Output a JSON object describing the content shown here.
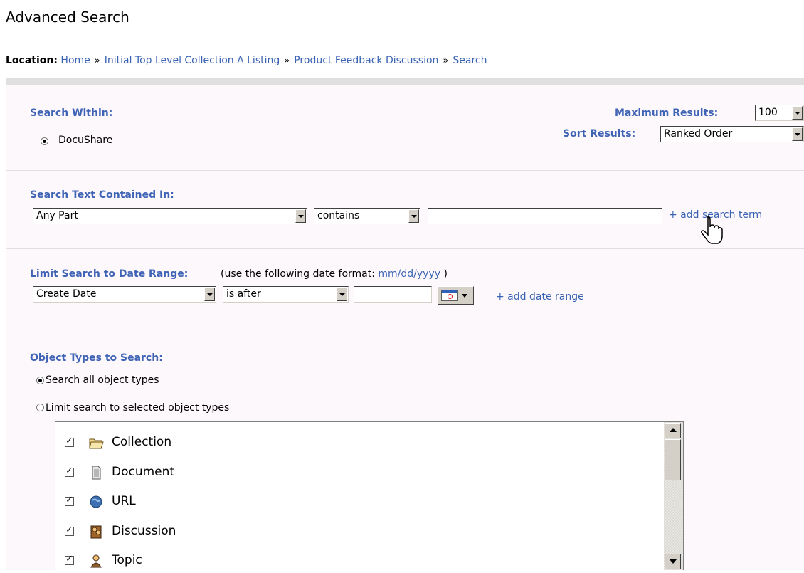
{
  "page": {
    "title": "Advanced Search"
  },
  "location": {
    "label": "Location:",
    "separator": "»",
    "crumbs": [
      "Home",
      "Initial Top Level Collection A Listing",
      "Product Feedback Discussion",
      "Search"
    ]
  },
  "search_within": {
    "label": "Search Within:",
    "option": "DocuShare",
    "selected": true
  },
  "max_results": {
    "label": "Maximum Results:",
    "value": "100"
  },
  "sort_results": {
    "label": "Sort Results:",
    "value": "Ranked Order"
  },
  "search_text": {
    "label": "Search Text Contained In:",
    "field_value": "Any Part",
    "operator_value": "contains",
    "term_value": "",
    "add_link": "+ add search term"
  },
  "date_range": {
    "label": "Limit Search to Date Range:",
    "hint_prefix": "(use the following date format:",
    "hint_format": "mm/dd/yyyy",
    "hint_suffix": ")",
    "field_value": "Create Date",
    "operator_value": "is after",
    "date_value": "",
    "add_link": "+ add date range",
    "calendar_icon": "calendar-icon"
  },
  "object_types": {
    "label": "Object Types to Search:",
    "option_all": "Search all object types",
    "option_limit": "Limit search to selected object types",
    "selected": "all",
    "items": [
      {
        "label": "Collection",
        "checked": true,
        "icon": "folder-icon"
      },
      {
        "label": "Document",
        "checked": true,
        "icon": "document-icon"
      },
      {
        "label": "URL",
        "checked": true,
        "icon": "globe-icon"
      },
      {
        "label": "Discussion",
        "checked": true,
        "icon": "discussion-icon"
      },
      {
        "label": "Topic",
        "checked": true,
        "icon": "topic-icon"
      }
    ]
  },
  "colors": {
    "link": "#3a63b3",
    "section_label": "#3f63b5",
    "form_bg": "#fdf8fc",
    "rule": "#e0e0e0"
  }
}
